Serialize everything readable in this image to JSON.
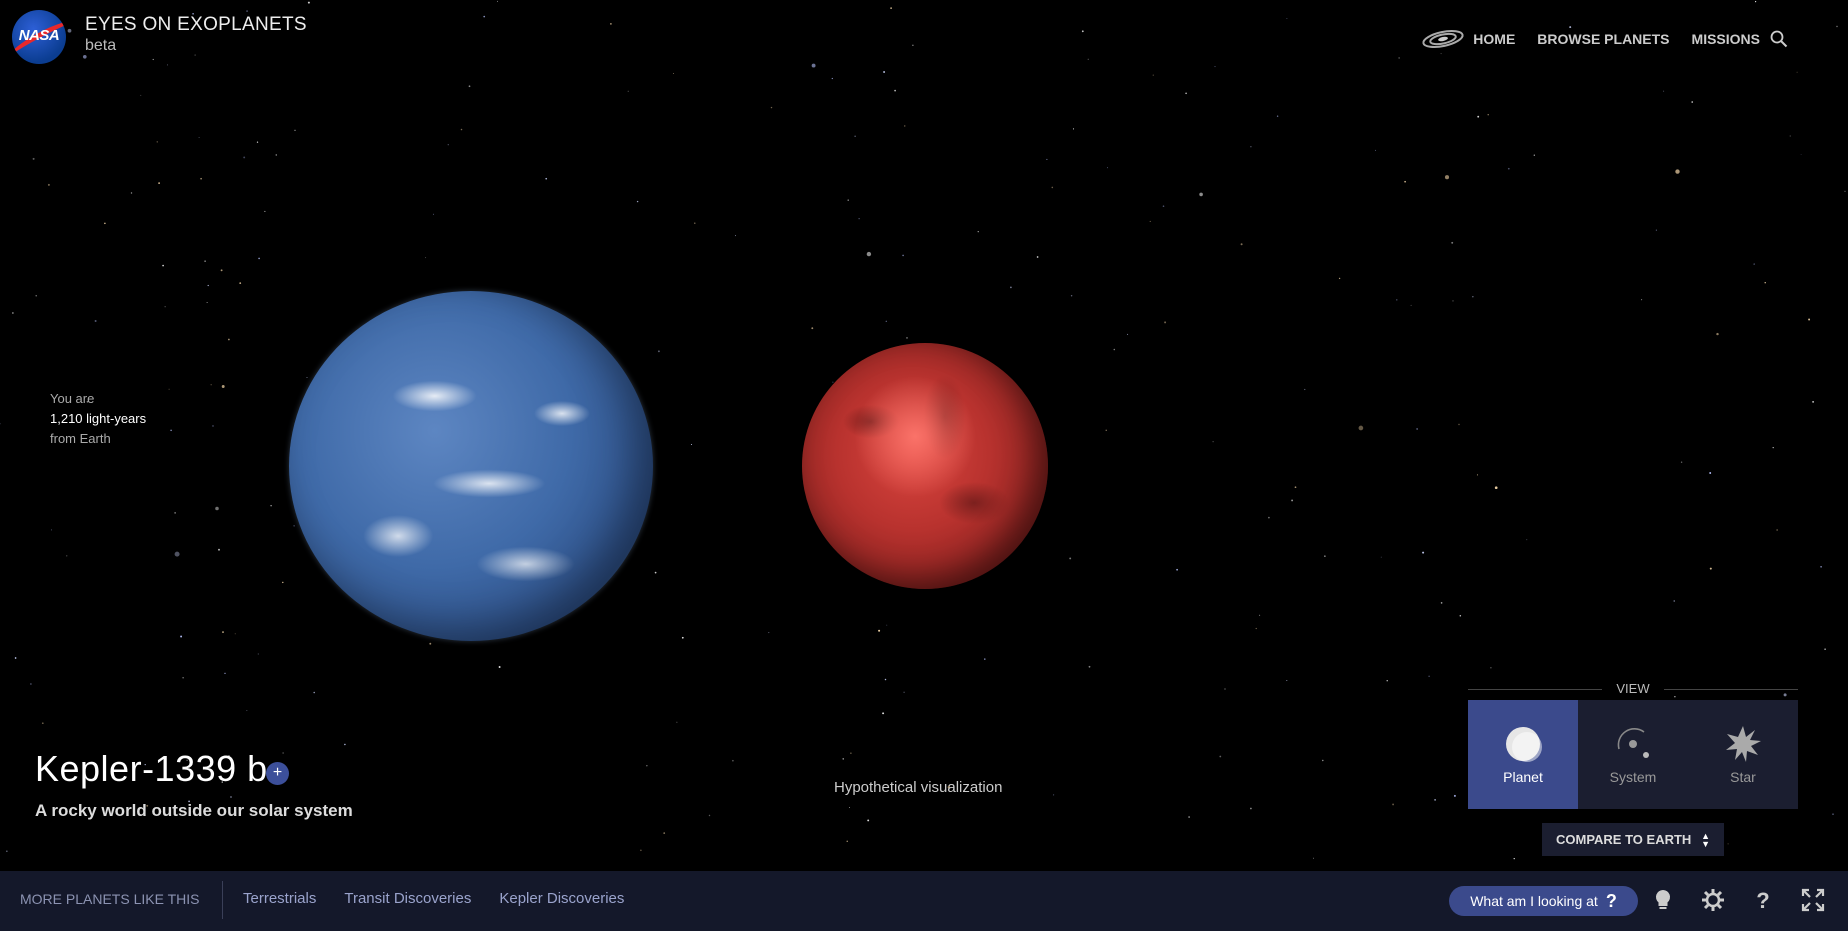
{
  "header": {
    "logo_text": "NASA",
    "title": "EYES ON EXOPLANETS",
    "subtitle": "beta",
    "nav": [
      "HOME",
      "BROWSE PLANETS",
      "MISSIONS"
    ]
  },
  "distance": {
    "prefix": "You are",
    "value": "1,210 light-years",
    "suffix": "from Earth"
  },
  "planet": {
    "name": "Kepler-1339 b",
    "add_label": "+",
    "description": "A rocky world outside our solar system",
    "visualization_note": "Hypothetical visualization"
  },
  "view": {
    "label": "VIEW",
    "options": [
      "Planet",
      "System",
      "Star"
    ],
    "selected": "Planet",
    "compare_label": "COMPARE TO EARTH"
  },
  "bottom": {
    "more_label": "MORE PLANETS LIKE THIS",
    "filters": [
      "Terrestrials",
      "Transit Discoveries",
      "Kepler Discoveries"
    ],
    "help_button": "What am I looking at",
    "help_mark": "?"
  },
  "icons": [
    "galaxy-icon",
    "search-icon",
    "lightbulb-icon",
    "settings-gear-icon",
    "help-icon",
    "fullscreen-icon"
  ]
}
